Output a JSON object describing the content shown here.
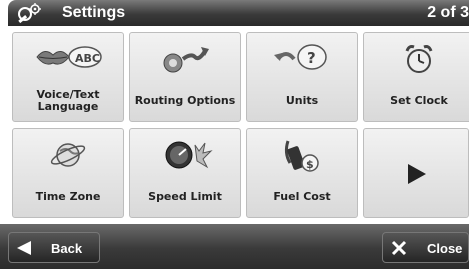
{
  "header": {
    "title": "Settings",
    "page_indicator": "2 of 3",
    "icon": "wrench-gear-icon"
  },
  "tiles": [
    {
      "label": "Voice/Text\nLanguage",
      "icon": "lips-abc-icon"
    },
    {
      "label": "Routing Options",
      "icon": "gear-arrow-icon"
    },
    {
      "label": "Units",
      "icon": "question-arrow-icon"
    },
    {
      "label": "Set Clock",
      "icon": "alarm-clock-icon"
    },
    {
      "label": "Time Zone",
      "icon": "globe-icon"
    },
    {
      "label": "Speed Limit",
      "icon": "speedometer-icon"
    },
    {
      "label": "Fuel Cost",
      "icon": "fuel-pump-icon"
    },
    {
      "label": "",
      "icon": "next-page-arrow-icon"
    }
  ],
  "footer": {
    "back_label": "Back",
    "close_label": "Close"
  }
}
